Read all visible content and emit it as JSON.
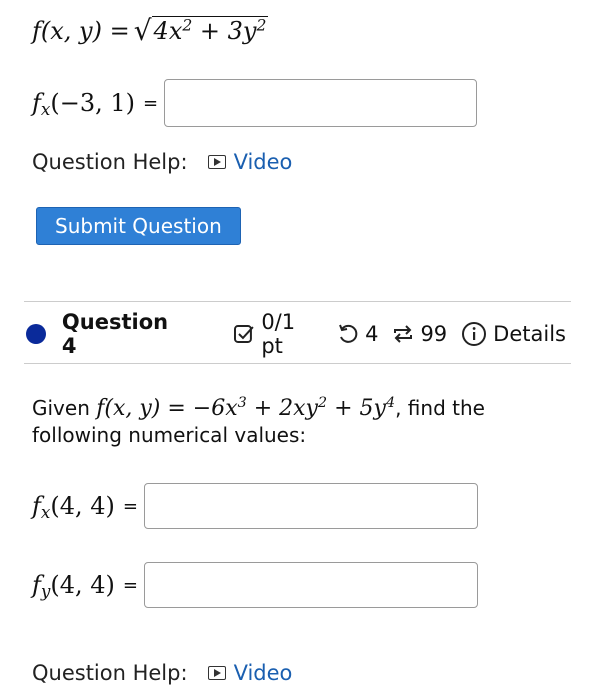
{
  "question3": {
    "function_lhs": "f(x, y) = ",
    "function_rad": "4x",
    "function_rad_exp1": "2",
    "function_rad_mid": " + 3y",
    "function_rad_exp2": "2",
    "answer_label_f": "f",
    "answer_label_sub": "x",
    "answer_label_args": "(−3, 1)",
    "equals": "=",
    "answer_value": "",
    "help_label": "Question Help:",
    "video_label": "Video",
    "submit_label": "Submit Question"
  },
  "question4": {
    "status_color": "#0a2a9a",
    "title": "Question 4",
    "score": "0/1 pt",
    "attempts": "4",
    "retries": "99",
    "details": "Details",
    "prompt_given": "Given ",
    "prompt_f": "f(x, y) = −6x",
    "prompt_e1": "3",
    "prompt_mid1": " + 2xy",
    "prompt_e2": "2",
    "prompt_mid2": " + 5y",
    "prompt_e3": "4",
    "prompt_tail": ", find the",
    "prompt_line2": "following numerical values:",
    "fx_f": "f",
    "fx_sub": "x",
    "fx_args": "(4, 4)",
    "fy_f": "f",
    "fy_sub": "y",
    "fy_args": "(4, 4)",
    "equals": "=",
    "fx_value": "",
    "fy_value": "",
    "help_label": "Question Help:",
    "video_label": "Video"
  },
  "icons": {
    "play": "play-icon",
    "checkbox": "checkbox-icon",
    "undo": "undo-icon",
    "retry": "retry-icon",
    "info": "info-icon"
  }
}
